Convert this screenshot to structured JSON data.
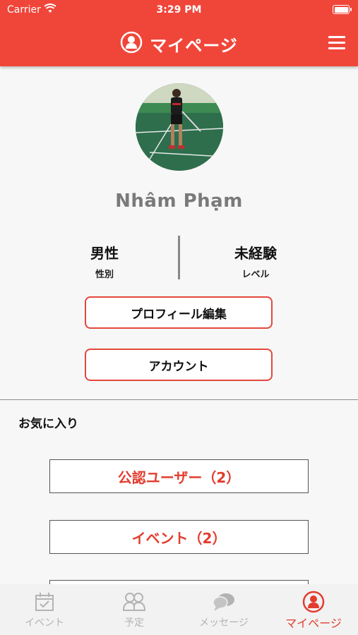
{
  "status_bar": {
    "carrier": "Carrier",
    "time": "3:29 PM"
  },
  "header": {
    "title": "マイページ",
    "icon": "user-circle-icon",
    "menu_icon": "hamburger-menu-icon",
    "color": "#f0463a"
  },
  "profile": {
    "name": "Nhâm Phạm",
    "gender_value": "男性",
    "gender_label": "性別",
    "level_value": "未経験",
    "level_label": "レベル"
  },
  "actions": {
    "edit_profile": "プロフィール編集",
    "account": "アカウント"
  },
  "favorites": {
    "title": "お気に入り",
    "items": [
      {
        "label": "公認ユーザー（2）"
      },
      {
        "label": "イベント（2）"
      }
    ]
  },
  "tabbar": {
    "tabs": [
      {
        "label": "イベント",
        "icon": "calendar-icon"
      },
      {
        "label": "予定",
        "icon": "people-icon"
      },
      {
        "label": "メッセージ",
        "icon": "chat-bubbles-icon"
      },
      {
        "label": "マイページ",
        "icon": "user-circle-icon",
        "active": true
      }
    ],
    "active_color": "#e23d2f",
    "inactive_color": "#b3b3b3"
  }
}
